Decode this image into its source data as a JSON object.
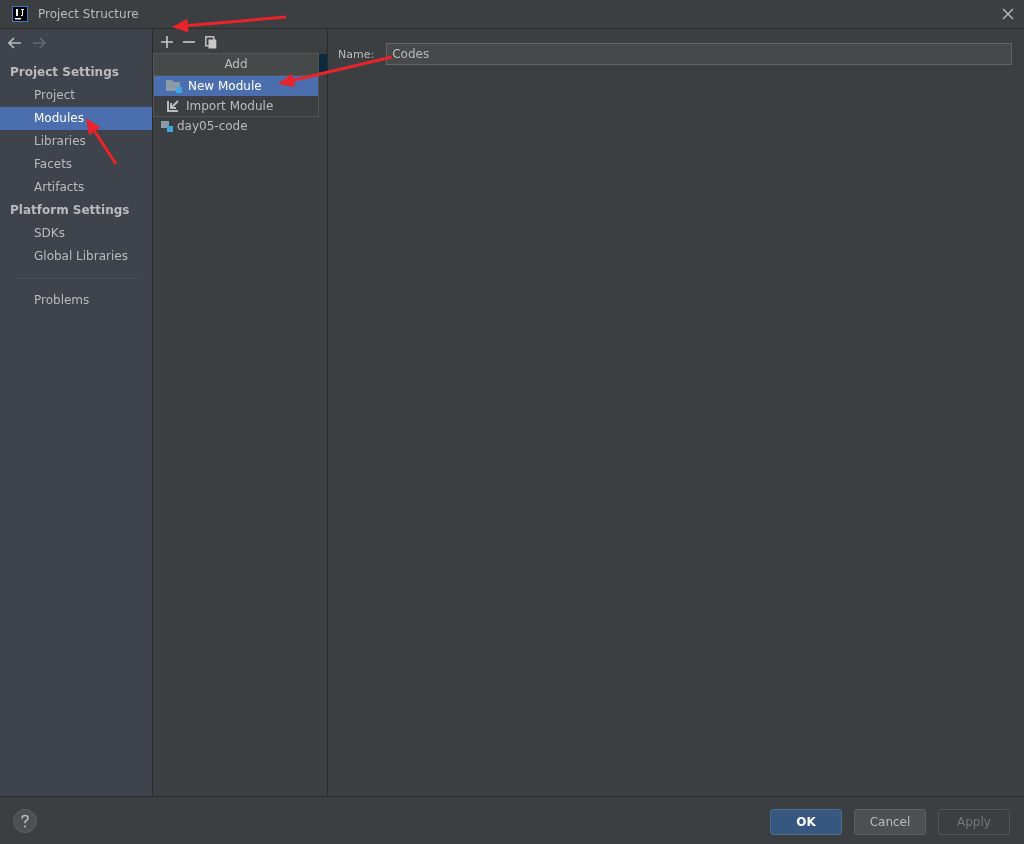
{
  "window": {
    "title": "Project Structure"
  },
  "sidebar": {
    "sections": [
      {
        "title": "Project Settings",
        "items": [
          {
            "label": "Project",
            "selected": false
          },
          {
            "label": "Modules",
            "selected": true
          },
          {
            "label": "Libraries",
            "selected": false
          },
          {
            "label": "Facets",
            "selected": false
          },
          {
            "label": "Artifacts",
            "selected": false
          }
        ]
      },
      {
        "title": "Platform Settings",
        "items": [
          {
            "label": "SDKs",
            "selected": false
          },
          {
            "label": "Global Libraries",
            "selected": false
          }
        ]
      }
    ],
    "extra_items": [
      {
        "label": "Problems",
        "selected": false
      }
    ]
  },
  "modules": [
    {
      "label": "day05-code"
    }
  ],
  "add_menu": {
    "title": "Add",
    "items": [
      {
        "label": "New Module",
        "kind": "new",
        "selected": true
      },
      {
        "label": "Import Module",
        "kind": "import",
        "selected": false
      }
    ]
  },
  "name_field": {
    "label": "Name:",
    "value": "Codes"
  },
  "buttons": [
    {
      "label": "OK",
      "kind": "default",
      "disabled": false
    },
    {
      "label": "Cancel",
      "kind": "normal",
      "disabled": false
    },
    {
      "label": "Apply",
      "kind": "normal",
      "disabled": true
    }
  ]
}
